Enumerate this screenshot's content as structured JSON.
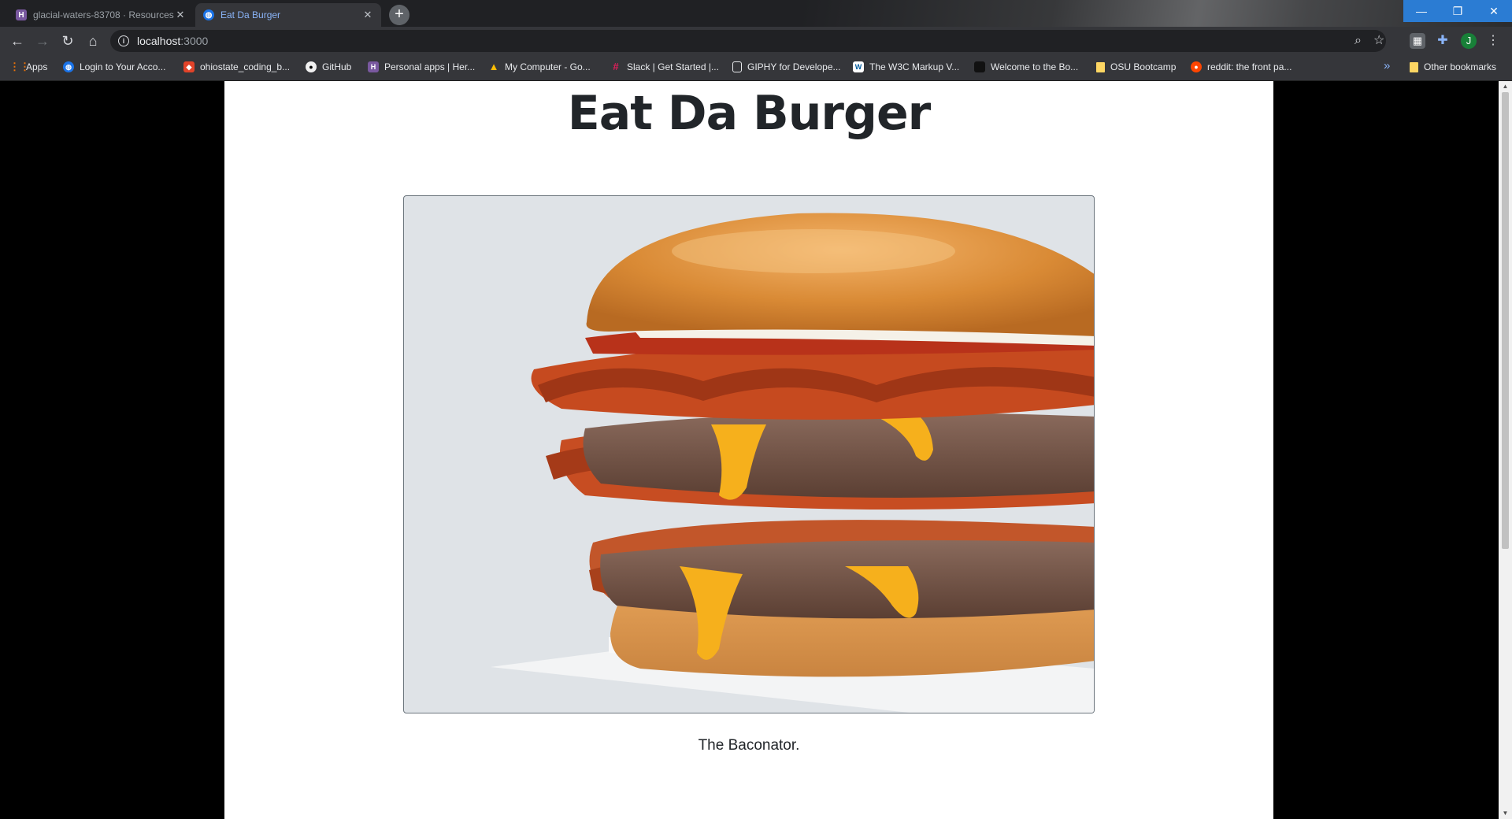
{
  "tabs": [
    {
      "title": "glacial-waters-83708 · Resources",
      "favicon": "heroku-icon",
      "active": false
    },
    {
      "title": "Eat Da Burger",
      "favicon": "globe-icon",
      "active": true
    }
  ],
  "address_bar": {
    "host": "localhost",
    "port": ":3000"
  },
  "bookmarks": [
    {
      "label": "Apps",
      "icon": "apps-grid-icon"
    },
    {
      "label": "Login to Your Acco...",
      "icon": "globe-icon"
    },
    {
      "label": "ohiostate_coding_b...",
      "icon": "gitlab-icon"
    },
    {
      "label": "GitHub",
      "icon": "github-icon"
    },
    {
      "label": "Personal apps | Her...",
      "icon": "heroku-icon"
    },
    {
      "label": "My Computer - Go...",
      "icon": "google-drive-icon"
    },
    {
      "label": "Slack | Get Started |...",
      "icon": "slack-icon"
    },
    {
      "label": "GIPHY for Develope...",
      "icon": "document-icon"
    },
    {
      "label": "The W3C Markup V...",
      "icon": "w3c-icon"
    },
    {
      "label": "Welcome to the Bo...",
      "icon": "bootcamp-icon"
    },
    {
      "label": "OSU Bootcamp",
      "icon": "folder-icon"
    },
    {
      "label": "reddit: the front pa...",
      "icon": "reddit-icon"
    }
  ],
  "overflow_label": "»",
  "other_bookmarks": "Other bookmarks",
  "profile_initial": "J",
  "page": {
    "heading": "Eat Da Burger",
    "burger_caption": "The Baconator."
  },
  "colors": {
    "accent": "#8ab4f8",
    "page_bg": "#ffffff",
    "chrome": "#35363a"
  }
}
